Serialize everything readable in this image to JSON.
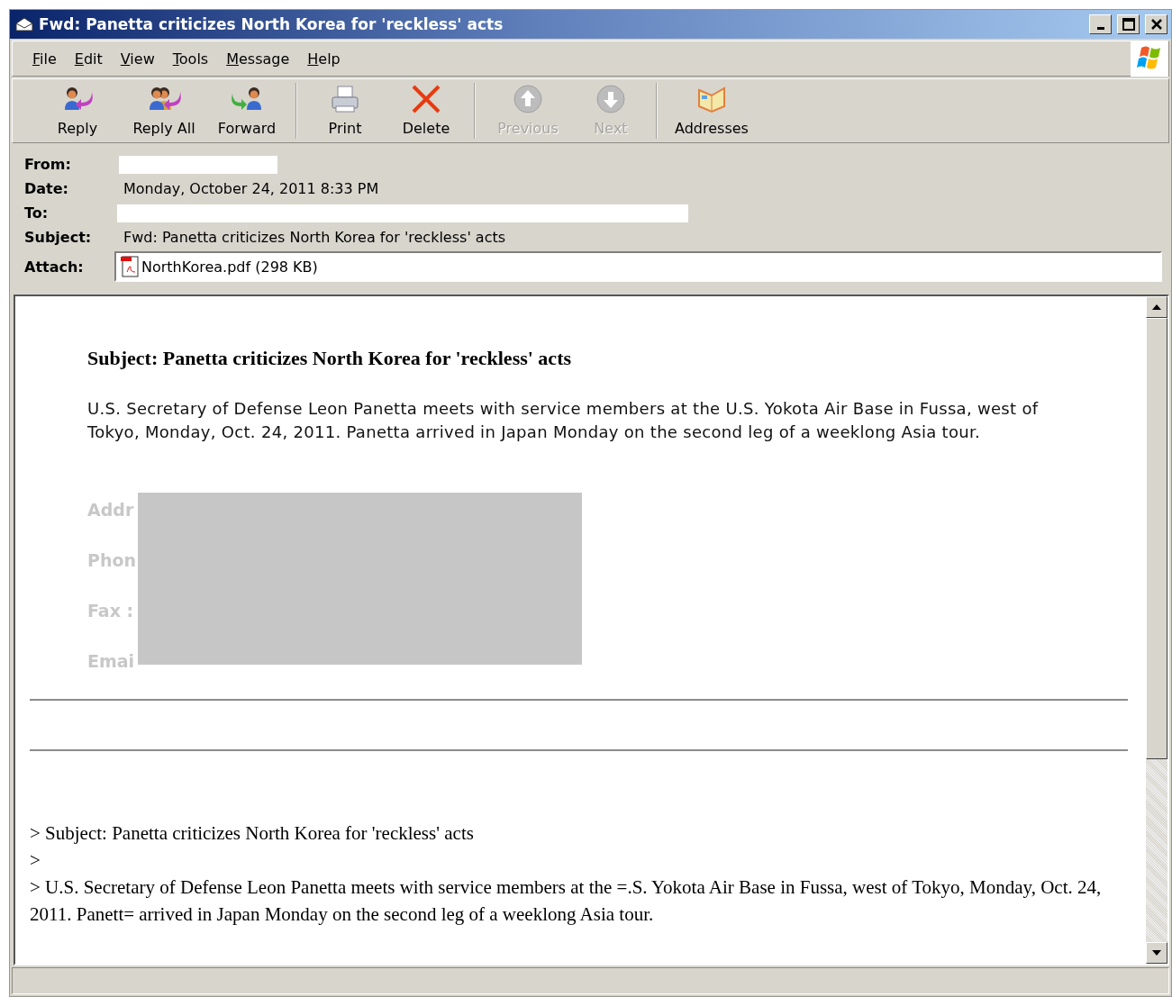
{
  "window": {
    "title": "Fwd: Panetta criticizes North Korea for 'reckless' acts"
  },
  "menu": [
    {
      "label": "File"
    },
    {
      "label": "Edit"
    },
    {
      "label": "View"
    },
    {
      "label": "Tools"
    },
    {
      "label": "Message"
    },
    {
      "label": "Help"
    }
  ],
  "toolbar": [
    [
      {
        "label": "Reply",
        "kind": "reply",
        "disabled": false
      },
      {
        "label": "Reply All",
        "kind": "replyall",
        "disabled": false
      },
      {
        "label": "Forward",
        "kind": "forward",
        "disabled": false
      }
    ],
    [
      {
        "label": "Print",
        "kind": "print",
        "disabled": false
      },
      {
        "label": "Delete",
        "kind": "delete",
        "disabled": false
      }
    ],
    [
      {
        "label": "Previous",
        "kind": "up",
        "disabled": true
      },
      {
        "label": "Next",
        "kind": "down",
        "disabled": true
      }
    ],
    [
      {
        "label": "Addresses",
        "kind": "book",
        "disabled": false
      }
    ]
  ],
  "headers": [
    {
      "label": "From:",
      "kind": "redacted"
    },
    {
      "label": "Date:",
      "kind": "text",
      "value": "Monday, October 24, 2011 8:33 PM"
    },
    {
      "label": "To:",
      "kind": "redacted"
    },
    {
      "label": "Subject:",
      "kind": "text",
      "value": "Fwd: Panetta criticizes North Korea for 'reckless' acts"
    },
    {
      "label": "Attach:",
      "kind": "attachment",
      "value": "NorthKorea.pdf (298 KB)"
    }
  ],
  "body": {
    "heading": "Subject: Panetta criticizes North Korea for 'reckless' acts",
    "paragraph": "U.S. Secretary of Defense Leon Panetta meets with service members at the U.S. Yokota Air Base in Fussa, west of Tokyo, Monday, Oct. 24, 2011. Panetta arrived in Japan Monday on the second leg of a weeklong Asia tour.",
    "contact_labels": [
      "Addr",
      "Phon",
      "Fax :",
      "Emai"
    ],
    "quoted_lines": [
      "> Subject: Panetta criticizes North Korea for 'reckless' acts",
      ">",
      "> U.S. Secretary of Defense Leon Panetta meets with service members at the =.S. Yokota Air Base in Fussa, west of Tokyo, Monday, Oct. 24, 2011. Panett= arrived in Japan Monday on the second leg of a weeklong Asia tour."
    ]
  }
}
